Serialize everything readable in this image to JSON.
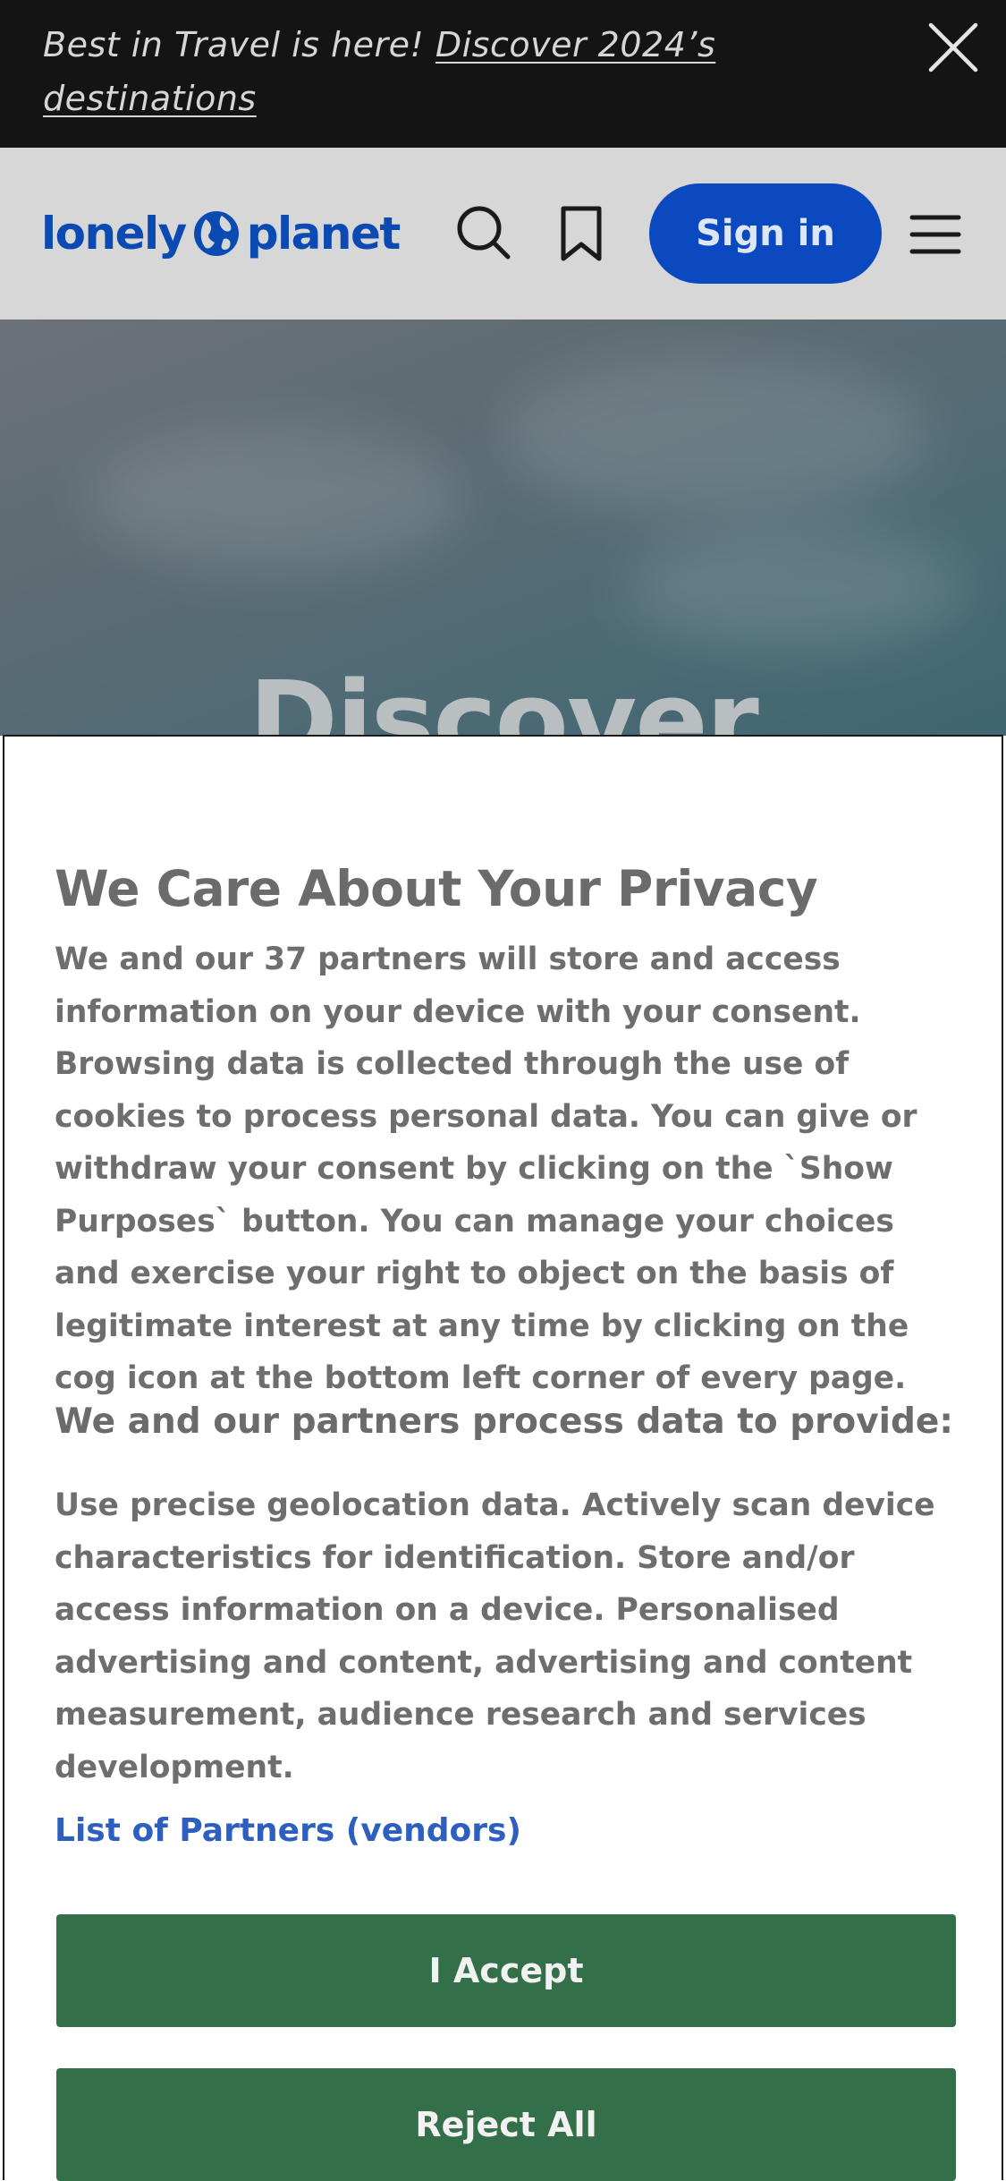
{
  "promo": {
    "text": "Best in Travel is here! ",
    "link": "Discover 2024’s destinations",
    "close_icon": "close-icon"
  },
  "header": {
    "logo_left": "lonely",
    "logo_right": "planet",
    "logo_icon": "globe-icon",
    "search_icon": "search-icon",
    "bookmark_icon": "bookmark-icon",
    "signin_label": "Sign in",
    "menu_icon": "hamburger-menu-icon",
    "brand_color": "#0b49c0"
  },
  "hero": {
    "title": "Discover"
  },
  "consent": {
    "title": "We Care About Your Privacy",
    "body": "We and our 37 partners will store and access information on your device with your consent. Browsing data is collected through the use of cookies to process personal data. You can give or withdraw your consent by clicking on the `Show Purposes` button. You can manage your choices and exercise your right to object on the basis of legitimate interest at any time by clicking on the cog icon at the bottom left corner of every page.",
    "subtitle": "We and our partners process data to provide:",
    "purposes": "Use precise geolocation data. Actively scan device characteristics for identification. Store and/or access information on a device. Personalised advertising and content, advertising and content measurement, audience research and services development.",
    "partners_link": "List of Partners (vendors)",
    "accept_label": "I Accept",
    "reject_label": "Reject All",
    "button_color": "#33704a"
  }
}
